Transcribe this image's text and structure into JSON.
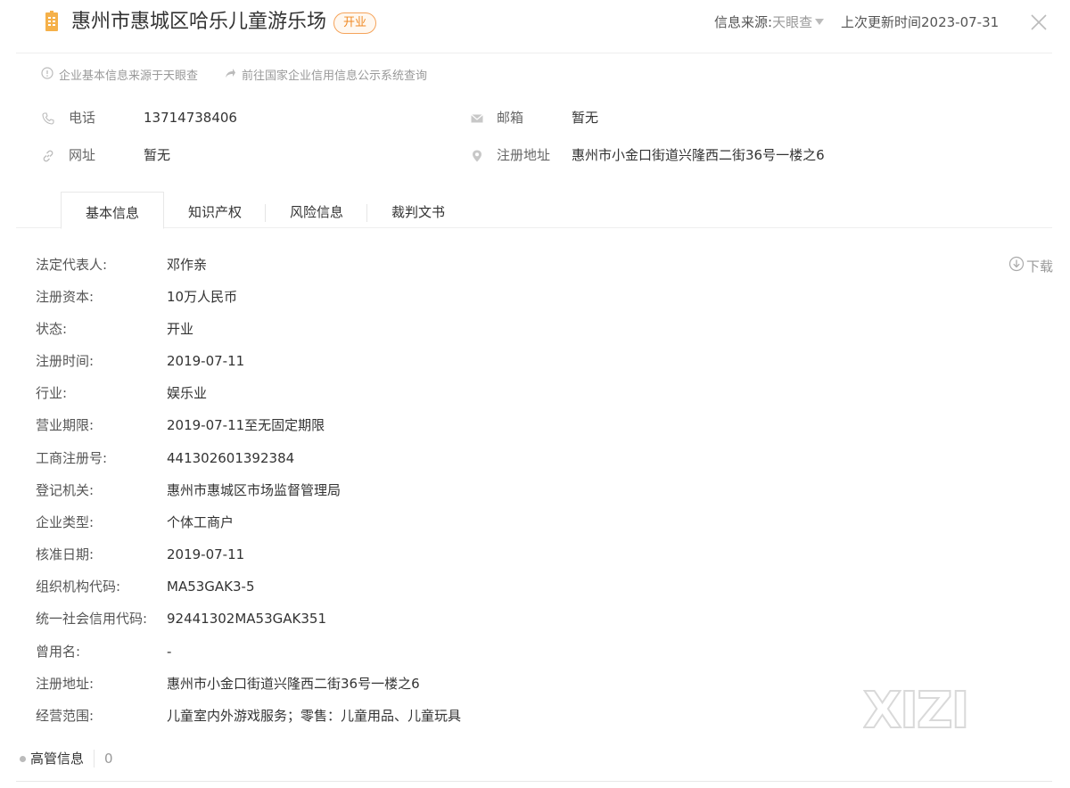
{
  "header": {
    "company_name": "惠州市惠城区哈乐儿童游乐场",
    "status": "开业",
    "source_label": "信息来源:",
    "source_value": "天眼查",
    "updated": "上次更新时间2023-07-31"
  },
  "notes": {
    "basic_source": "企业基本信息来源于天眼查",
    "gov_link": "前往国家企业信用信息公示系统查询"
  },
  "contacts": {
    "phone_label": "电话",
    "phone": "13714738406",
    "email_label": "邮箱",
    "email": "暂无",
    "website_label": "网址",
    "website": "暂无",
    "address_label": "注册地址",
    "address": "惠州市小金口街道兴隆西二街36号一楼之6"
  },
  "tabs": [
    "基本信息",
    "知识产权",
    "风险信息",
    "裁判文书"
  ],
  "active_tab": "基本信息",
  "download_label": "下载",
  "info": [
    {
      "key": "法定代表人:",
      "value": "邓作亲"
    },
    {
      "key": "注册资本:",
      "value": "10万人民币"
    },
    {
      "key": "状态:",
      "value": "开业"
    },
    {
      "key": "注册时间:",
      "value": "2019-07-11"
    },
    {
      "key": "行业:",
      "value": "娱乐业"
    },
    {
      "key": "营业期限:",
      "value": "2019-07-11至无固定期限"
    },
    {
      "key": "工商注册号:",
      "value": "441302601392384"
    },
    {
      "key": "登记机关:",
      "value": "惠州市惠城区市场监督管理局"
    },
    {
      "key": "企业类型:",
      "value": "个体工商户"
    },
    {
      "key": "核准日期:",
      "value": "2019-07-11"
    },
    {
      "key": "组织机构代码:",
      "value": "MA53GAK3-5"
    },
    {
      "key": "统一社会信用代码:",
      "value": "92441302MA53GAK351"
    },
    {
      "key": "曾用名:",
      "value": "-"
    },
    {
      "key": "注册地址:",
      "value": "惠州市小金口街道兴隆西二街36号一楼之6"
    },
    {
      "key": "经营范围:",
      "value": "儿童室内外游戏服务；零售：儿童用品、儿童玩具"
    }
  ],
  "executives": {
    "label": "高管信息",
    "count": "0"
  },
  "watermark": "XIZI",
  "colors": {
    "accent": "#f08a24",
    "badge_border": "#f5a35a",
    "icon_orange": "#f5b14a"
  }
}
